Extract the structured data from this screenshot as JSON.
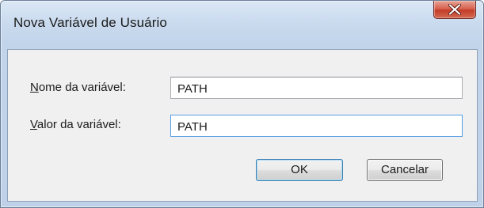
{
  "window": {
    "title": "Nova Variável de Usuário"
  },
  "form": {
    "name_label_mnemonic": "N",
    "name_label_rest": "ome da variável:",
    "name_value": "PATH",
    "value_label_mnemonic": "V",
    "value_label_rest": "alor da variável:",
    "value_value": "PATH"
  },
  "buttons": {
    "ok_label": "OK",
    "cancel_label": "Cancelar"
  },
  "icons": {
    "close": "close-icon"
  },
  "colors": {
    "close_button": "#c43d27",
    "focus_border": "#569de5",
    "frame": "#bfd1e8"
  }
}
